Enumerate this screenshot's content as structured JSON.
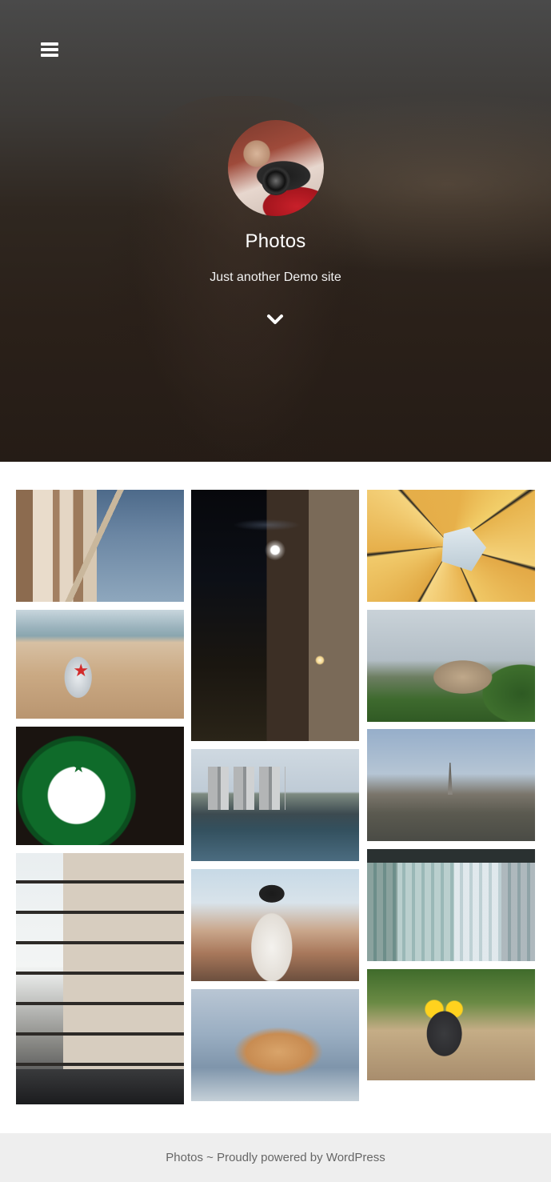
{
  "header": {
    "menu_icon": "hamburger-menu-icon",
    "site_title": "Photos",
    "site_description": "Just another Demo site",
    "scroll_icon": "chevron-down-icon",
    "avatar": "photographer-avatar"
  },
  "gallery": {
    "items": [
      {
        "subject": "classical columns"
      },
      {
        "subject": "night street with moon"
      },
      {
        "subject": "umbrella canopy"
      },
      {
        "subject": "can on beach"
      },
      {
        "subject": "colosseum"
      },
      {
        "subject": "starbucks sign"
      },
      {
        "subject": "paris cityscape"
      },
      {
        "subject": "river with boats"
      },
      {
        "subject": "parisian building"
      },
      {
        "subject": "woman with camera"
      },
      {
        "subject": "glass structure"
      },
      {
        "subject": "cat lying"
      },
      {
        "subject": "toy owl"
      }
    ]
  },
  "footer": {
    "site_name": "Photos",
    "separator": " ~ ",
    "powered_text": "Proudly powered by WordPress"
  },
  "colors": {
    "footer_bg": "#eeeeee",
    "footer_text": "#666666",
    "hero_text": "#ffffff"
  }
}
